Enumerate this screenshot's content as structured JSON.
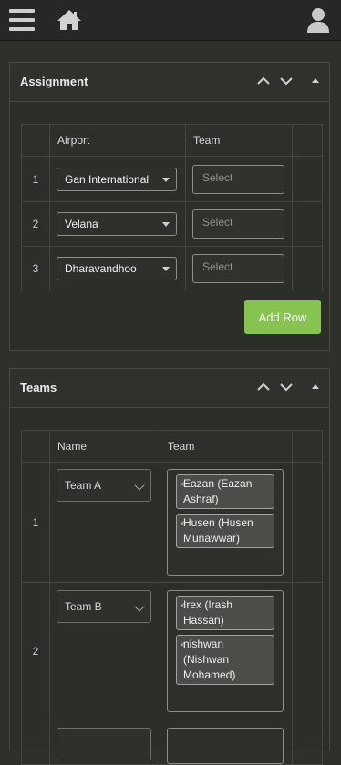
{
  "topbar": {
    "menu_icon": "hamburger-icon",
    "home_icon": "home-icon",
    "user_icon": "user-icon"
  },
  "assignment": {
    "title": "Assignment",
    "columns": {
      "airport": "Airport",
      "team": "Team"
    },
    "rows": [
      {
        "index": "1",
        "airport": "Gan International",
        "team_placeholder": "Select"
      },
      {
        "index": "2",
        "airport": "Velana",
        "team_placeholder": "Select"
      },
      {
        "index": "3",
        "airport": "Dharavandhoo",
        "team_placeholder": "Select"
      }
    ],
    "add_row_label": "Add Row",
    "add_row_color": "#86c351"
  },
  "teams": {
    "title": "Teams",
    "columns": {
      "name": "Name",
      "team": "Team"
    },
    "rows": [
      {
        "index": "1",
        "name": "Team A",
        "members": [
          "Eazan (Eazan Ashraf)",
          "Husen (Husen Munawwar)"
        ]
      },
      {
        "index": "2",
        "name": "Team B",
        "members": [
          "Irex (Irash Hassan)",
          "nishwan (Nishwan Mohamed)"
        ]
      }
    ]
  },
  "remove_symbol": "×"
}
